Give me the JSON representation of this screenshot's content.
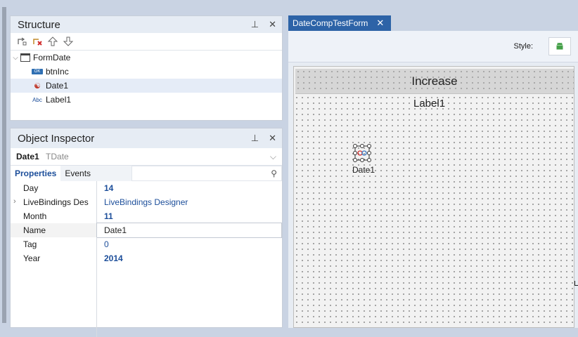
{
  "structure": {
    "title": "Structure",
    "pin": "⊥",
    "close": "✕",
    "tree": [
      {
        "label": "FormDate",
        "icon": "form-icon"
      },
      {
        "label": "btnInc",
        "icon": "button-icon"
      },
      {
        "label": "Date1",
        "icon": "date-component-icon"
      },
      {
        "label": "Label1",
        "icon": "label-icon"
      }
    ]
  },
  "inspector": {
    "title": "Object Inspector",
    "pin": "⊥",
    "close": "✕",
    "object_name": "Date1",
    "object_type": "TDate",
    "tabs": [
      "Properties",
      "Events"
    ],
    "properties": [
      {
        "name": "Day",
        "value": "14"
      },
      {
        "name": "LiveBindings Des",
        "value": "LiveBindings Designer"
      },
      {
        "name": "Month",
        "value": "11"
      },
      {
        "name": "Name",
        "value": "Date1"
      },
      {
        "name": "Tag",
        "value": "0"
      },
      {
        "name": "Year",
        "value": "2014"
      }
    ]
  },
  "designer": {
    "tab_title": "DateCompTestForm",
    "style_label": "Style:",
    "button_text": "Increase",
    "label_text": "Label1",
    "date_caption": "Date1"
  },
  "colors": {
    "accent": "#2d63a7",
    "selected_row": "#e5ecf7",
    "value_blue": "#1c4e9a"
  }
}
